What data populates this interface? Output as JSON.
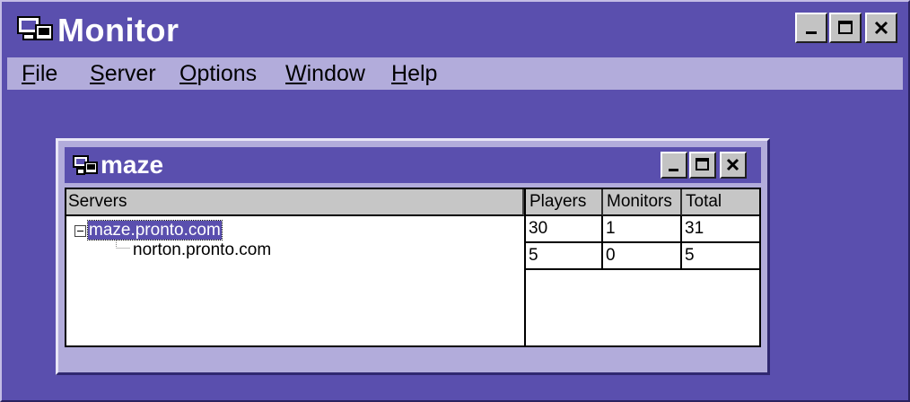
{
  "app": {
    "title": "Monitor",
    "icon": "monitor-app-icon"
  },
  "window_buttons": {
    "minimize": "_",
    "maximize": "□",
    "close": "×"
  },
  "menu": {
    "items": [
      {
        "label": "File",
        "mnemonic": "F",
        "rest": "ile"
      },
      {
        "label": "Server",
        "mnemonic": "S",
        "rest": "erver"
      },
      {
        "label": "Options",
        "mnemonic": "O",
        "rest": "ptions"
      },
      {
        "label": "Window",
        "mnemonic": "W",
        "rest": "indow"
      },
      {
        "label": "Help",
        "mnemonic": "H",
        "rest": "elp"
      }
    ]
  },
  "child_window": {
    "title": "maze",
    "icon": "server-window-icon"
  },
  "tree": {
    "header": "Servers",
    "nodes": [
      {
        "label": "maze.pronto.com",
        "expanded": true,
        "selected": true
      },
      {
        "label": "norton.pronto.com",
        "expanded": false,
        "selected": false
      }
    ]
  },
  "grid": {
    "columns": [
      "Players",
      "Monitors",
      "Total"
    ],
    "rows": [
      [
        "30",
        "1",
        "31"
      ],
      [
        "5",
        "0",
        "5"
      ]
    ]
  },
  "colors": {
    "background": "#5a4fae",
    "menubar": "#b2acdb",
    "selection": "#5a4fae"
  }
}
